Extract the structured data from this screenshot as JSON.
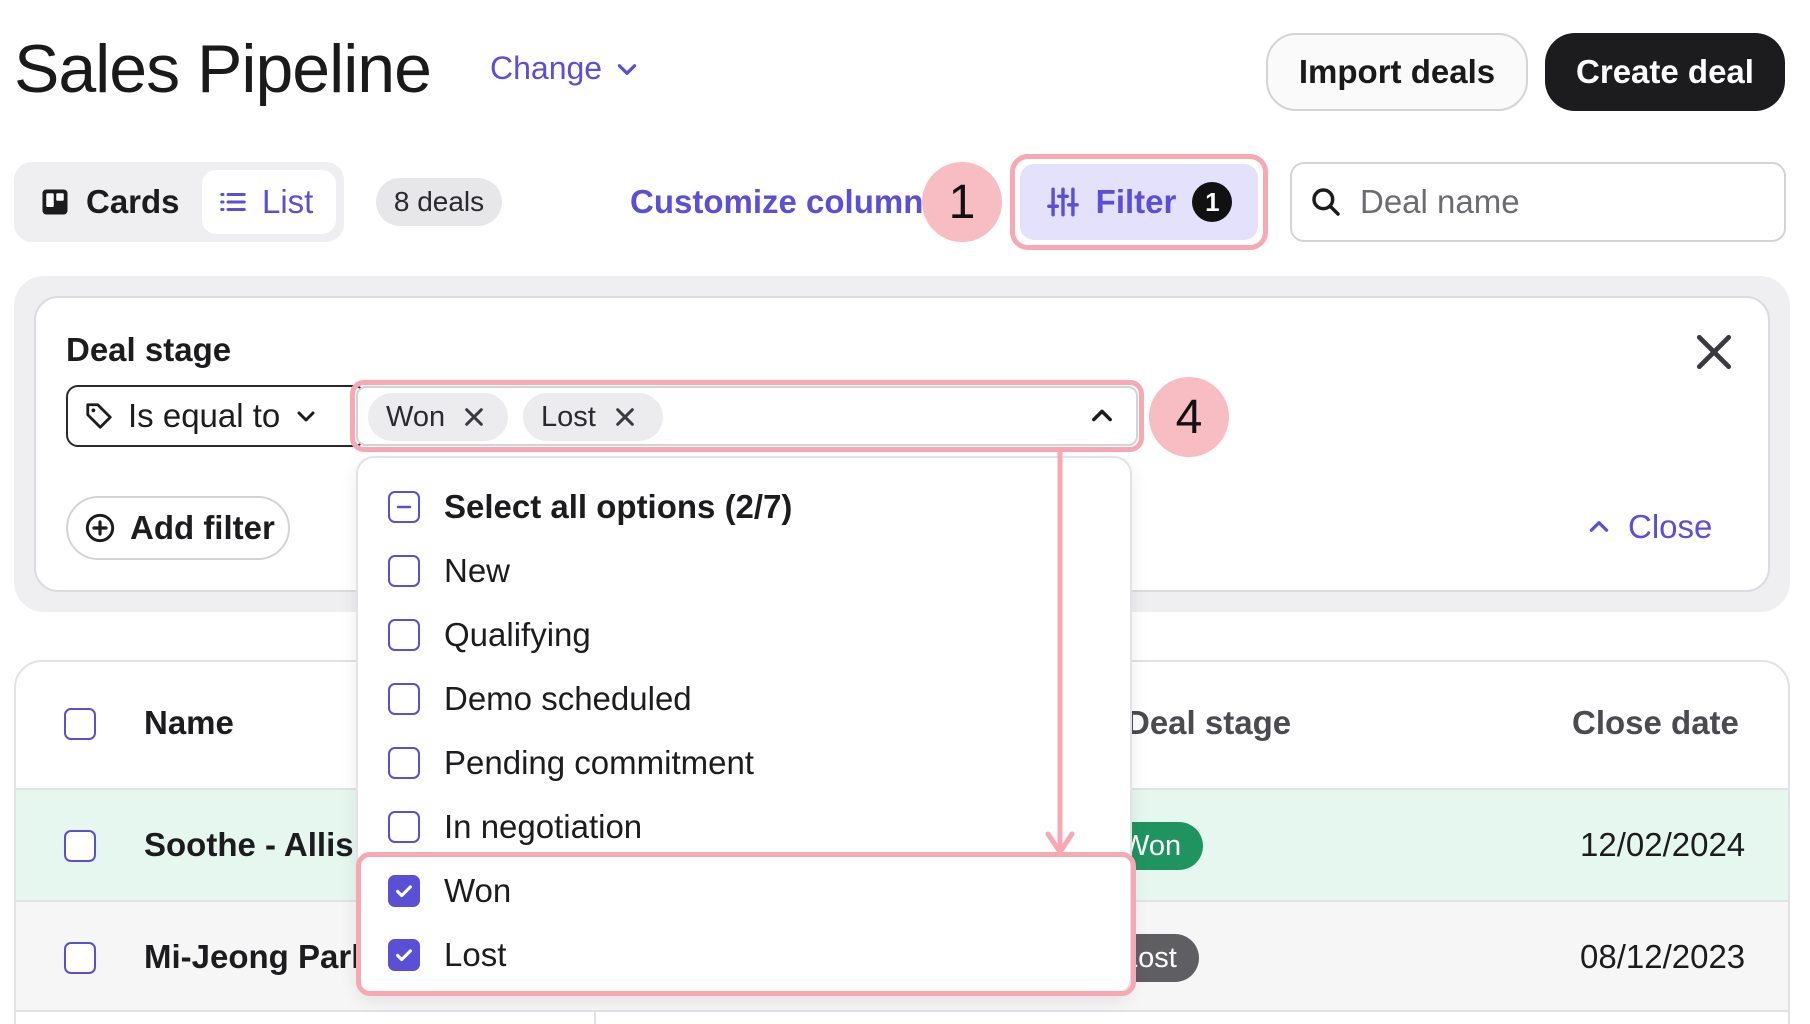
{
  "header": {
    "title": "Sales Pipeline",
    "change_label": "Change",
    "import_label": "Import deals",
    "create_label": "Create deal"
  },
  "toolbar": {
    "views": [
      {
        "label": "Cards",
        "icon": "cards-icon",
        "active": false
      },
      {
        "label": "List",
        "icon": "list-icon",
        "active": true
      }
    ],
    "deals_count": "8 deals",
    "customize_label": "Customize columns",
    "filter_label": "Filter",
    "filter_count": "1",
    "search_placeholder": "Deal name"
  },
  "annotations": {
    "step_filter": "1",
    "step_values": "4"
  },
  "filter_panel": {
    "field_label": "Deal stage",
    "operator": "Is equal to",
    "selected_values": [
      "Won",
      "Lost"
    ],
    "add_filter_label": "Add filter",
    "close_label": "Close"
  },
  "dropdown": {
    "select_all_label": "Select all options (2/7)",
    "options": [
      {
        "label": "New",
        "checked": false
      },
      {
        "label": "Qualifying",
        "checked": false
      },
      {
        "label": "Demo scheduled",
        "checked": false
      },
      {
        "label": "Pending commitment",
        "checked": false
      },
      {
        "label": "In negotiation",
        "checked": false
      },
      {
        "label": "Won",
        "checked": true
      },
      {
        "label": "Lost",
        "checked": true
      }
    ]
  },
  "table": {
    "columns": [
      "Name",
      "Deal stage",
      "Close date"
    ],
    "rows": [
      {
        "name": "Soothe - Allis D",
        "stage": "Won",
        "close_date": "12/02/2024"
      },
      {
        "name": "Mi-Jeong Park",
        "stage": "Lost",
        "close_date": "08/12/2023"
      }
    ]
  },
  "colors": {
    "accent": "#5b4fd6",
    "highlight": "#f7a8b2",
    "won": "#1f9461",
    "lost": "#5f5f63"
  }
}
